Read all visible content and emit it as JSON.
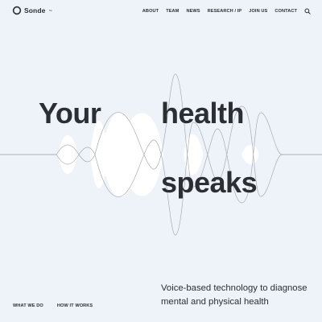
{
  "brand": {
    "name": "Sonde",
    "trademark": "™"
  },
  "nav": {
    "items": [
      {
        "label": "ABOUT"
      },
      {
        "label": "TEAM"
      },
      {
        "label": "NEWS"
      },
      {
        "label": "RESEARCH / IP"
      },
      {
        "label": "JOIN US"
      },
      {
        "label": "CONTACT"
      }
    ],
    "search_icon": "search-icon"
  },
  "hero": {
    "word_1": "Your",
    "word_2": "health",
    "word_3": "speaks",
    "tagline": "Voice-based technology to diagnose mental and physical health"
  },
  "footer_links": {
    "what_we_do": "WHAT WE DO",
    "how_it_works": "HOW IT WORKS"
  },
  "colors": {
    "background": "#edf3f8",
    "text": "#2b2e33",
    "wave_line": "#a9adb3",
    "wave_fill": "#ffffff"
  }
}
